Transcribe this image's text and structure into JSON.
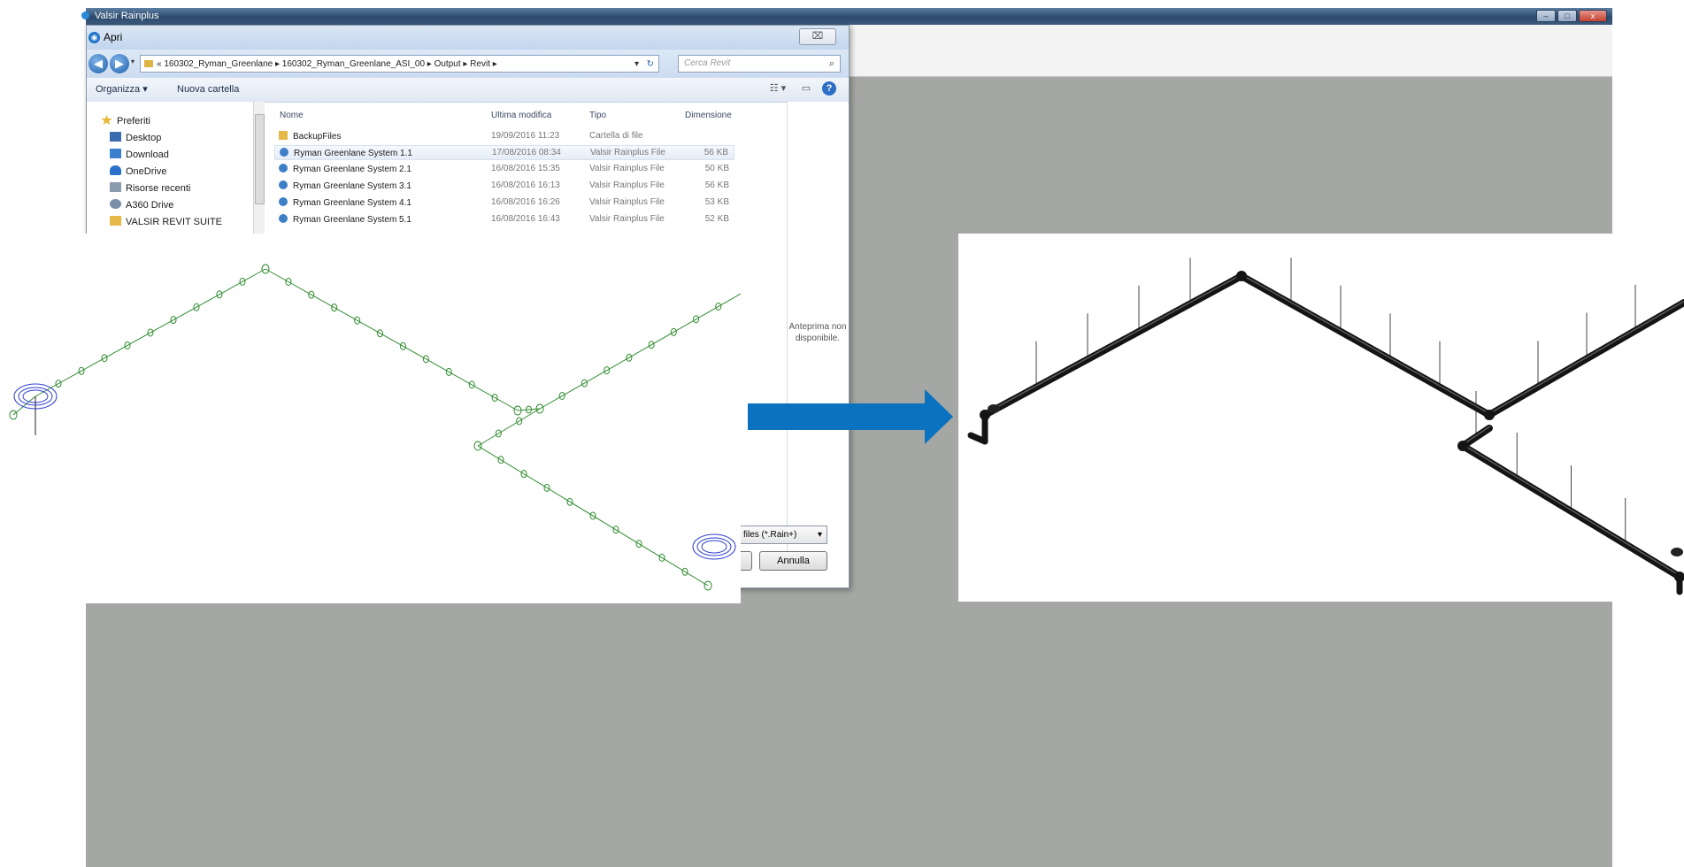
{
  "app": {
    "title": "Valsir Rainplus",
    "window_buttons": {
      "minimize": "–",
      "maximize": "□",
      "close": "x"
    }
  },
  "dialog": {
    "title": "Apri",
    "close": "⌧",
    "nav": {
      "back": "◀",
      "forward": "▶",
      "recent": "▾"
    },
    "breadcrumb": "« 160302_Ryman_Greenlane ▸ 160302_Ryman_Greenlane_ASI_00 ▸ Output ▸ Revit ▸",
    "address_dropdown": "▾",
    "refresh": "↻",
    "search_placeholder": "Cerca Revit",
    "search_icon": "⌕",
    "toolbar": {
      "organize": "Organizza ▾",
      "new_folder": "Nuova cartella",
      "view": "☷ ▾",
      "pane": "▭",
      "help": "?"
    },
    "nav_items": [
      {
        "label": "Preferiti",
        "icon": "star-icon",
        "color": "#e8b93a"
      },
      {
        "label": "Desktop",
        "icon": "desktop-icon",
        "color": "#3b6cb0"
      },
      {
        "label": "Download",
        "icon": "download-icon",
        "color": "#3b7fd0"
      },
      {
        "label": "OneDrive",
        "icon": "cloud-icon",
        "color": "#2a6fc9"
      },
      {
        "label": "Risorse recenti",
        "icon": "recent-places-icon",
        "color": "#8a9bb0"
      },
      {
        "label": "A360 Drive",
        "icon": "a360-drive-icon",
        "color": "#7a8fa8"
      },
      {
        "label": "VALSIR REVIT SUITE",
        "icon": "folder-icon",
        "color": "#e5b848"
      }
    ],
    "columns": {
      "name": "Nome",
      "modified": "Ultima modifica",
      "type": "Tipo",
      "size": "Dimensione"
    },
    "files": [
      {
        "name": "BackupFiles",
        "modified": "19/09/2016 11:23",
        "type": "Cartella di file",
        "size": "",
        "icon": "folder-icon"
      },
      {
        "name": "Ryman Greenlane System 1.1",
        "modified": "17/08/2016 08:34",
        "type": "Valsir Rainplus File",
        "size": "56 KB",
        "icon": "rainplus-file-icon"
      },
      {
        "name": "Ryman Greenlane System 2.1",
        "modified": "16/08/2016 15:35",
        "type": "Valsir Rainplus File",
        "size": "50 KB",
        "icon": "rainplus-file-icon"
      },
      {
        "name": "Ryman Greenlane System 3.1",
        "modified": "16/08/2016 16:13",
        "type": "Valsir Rainplus File",
        "size": "56 KB",
        "icon": "rainplus-file-icon"
      },
      {
        "name": "Ryman Greenlane System 4.1",
        "modified": "16/08/2016 16:26",
        "type": "Valsir Rainplus File",
        "size": "53 KB",
        "icon": "rainplus-file-icon"
      },
      {
        "name": "Ryman Greenlane System 5.1",
        "modified": "16/08/2016 16:43",
        "type": "Valsir Rainplus File",
        "size": "52 KB",
        "icon": "rainplus-file-icon"
      }
    ],
    "preview_text": "Anteprima non disponibile.",
    "filter": "files (*.Rain+)",
    "filter_dropdown": "▾",
    "cancel": "Annulla"
  },
  "colors": {
    "schematic_line": "#2e8b2e",
    "schematic_outlet": "#2d3fd0",
    "arrow": "#0b72c0",
    "pipe": "#141414",
    "desktop": "#a4a7a3"
  }
}
